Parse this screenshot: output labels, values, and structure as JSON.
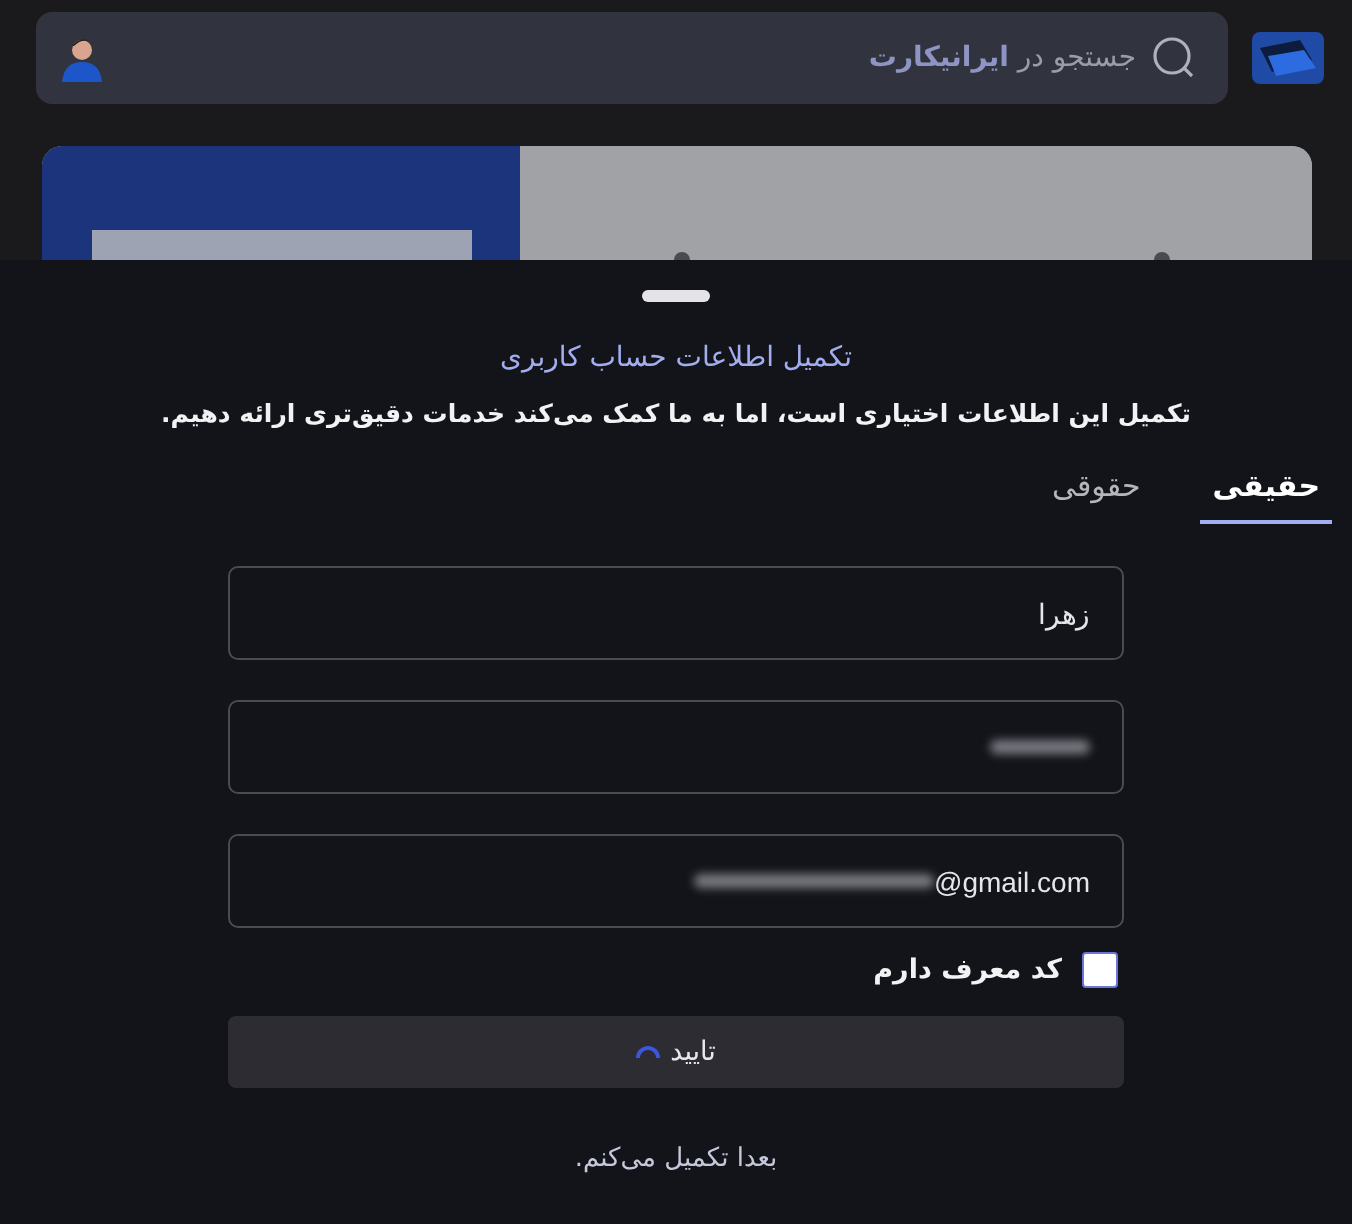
{
  "header": {
    "search": {
      "placeholder_prefix": "جستجو در",
      "placeholder_brand": "ایرانیکارت"
    }
  },
  "sheet": {
    "title": "تکمیل اطلاعات حساب کاربری",
    "subtitle": "تکمیل این اطلاعات اختیاری است، اما به ما کمک می‌کند خدمات دقیق‌تری ارائه دهیم.",
    "tabs": [
      {
        "label": "حقیقی",
        "selected": true
      },
      {
        "label": "حقوقی",
        "selected": false
      }
    ],
    "fields": [
      {
        "value": "زهرا",
        "redacted": false
      },
      {
        "redacted": true
      },
      {
        "value": "@gmail.com",
        "redacted": true
      }
    ],
    "referral": {
      "label": "کد معرف دارم",
      "checked": false
    },
    "submit": {
      "label": "تایید",
      "loading": true
    },
    "later_link": "بعدا تکمیل می‌کنم."
  }
}
